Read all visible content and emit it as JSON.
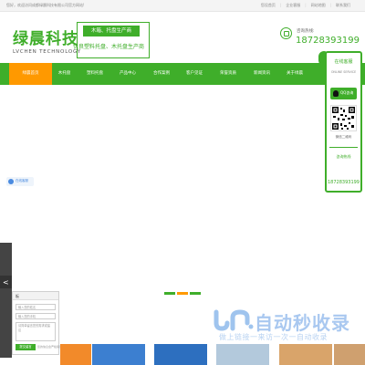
{
  "topbar": {
    "welcome": "您好，欢迎访问成都绿晨科技有限公司官方网站!",
    "links": [
      "您设首页",
      "企业客服",
      "网站地图",
      "联系我们"
    ]
  },
  "logo": {
    "cn": "绿晨科技",
    "en": "LVCHEN TECHNOLOGY"
  },
  "slogan": {
    "top": "木箱、托盘生产商",
    "bottom": "优良塑料托盘、木托盘生产商"
  },
  "hotline": {
    "label": "咨询热线:",
    "number": "18728393199"
  },
  "nav": {
    "items": [
      {
        "label": "绿晨首页"
      },
      {
        "label": "木托盘"
      },
      {
        "label": "塑料托盘"
      },
      {
        "label": "产品中心"
      },
      {
        "label": "合作案例"
      },
      {
        "label": "客户见证"
      },
      {
        "label": "荣誉资质"
      },
      {
        "label": "新闻资讯"
      },
      {
        "label": "关于绿晨"
      }
    ]
  },
  "online_widget": {
    "label": "在线客服"
  },
  "form": {
    "title": "板",
    "name_placeholder": "输入您的姓名",
    "phone_placeholder": "输入您的手机",
    "message_placeholder": "请简单留言您的需求或建议",
    "submit_label": "提交留言",
    "footnote": "您的信息会严格保密"
  },
  "cs_widget": {
    "title": "在线客服",
    "subtitle": "ONLINE SERVICE",
    "qq_label": "QQ咨询",
    "qr_label": "微信二维码",
    "hotline_label": "咨询热线",
    "hotline_number": "18728393199"
  },
  "watermark": {
    "big": "自动秒收录",
    "small": "做上链接一来访一次一自动收录"
  },
  "colors": {
    "brand_green": "#3fae2a",
    "accent_orange": "#ff9900"
  }
}
